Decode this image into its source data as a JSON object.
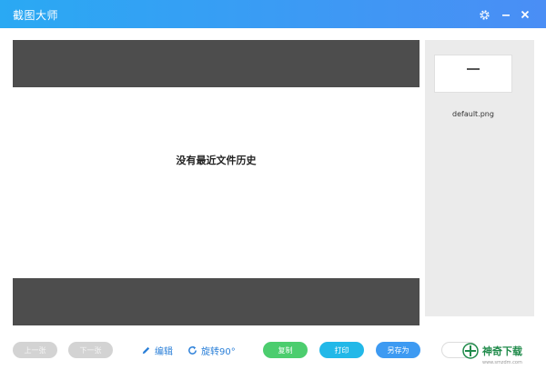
{
  "app": {
    "title": "截图大师"
  },
  "viewer": {
    "empty_message": "没有最近文件历史"
  },
  "thumbnails": [
    {
      "filename": "default.png"
    }
  ],
  "toolbar": {
    "prev": "上一张",
    "next": "下一张",
    "edit": "编辑",
    "rotate": "旋转90°",
    "copy": "复制",
    "print": "打印",
    "save_as": "另存为"
  },
  "watermark": {
    "text": "神奇下载",
    "site": "www.smzdm.com"
  },
  "colors": {
    "title_bar": "#3a9cf4",
    "copy": "#4ccd6e",
    "print": "#22b8e8",
    "save_as": "#3d9af2",
    "tool_text": "#2a7fd8"
  }
}
